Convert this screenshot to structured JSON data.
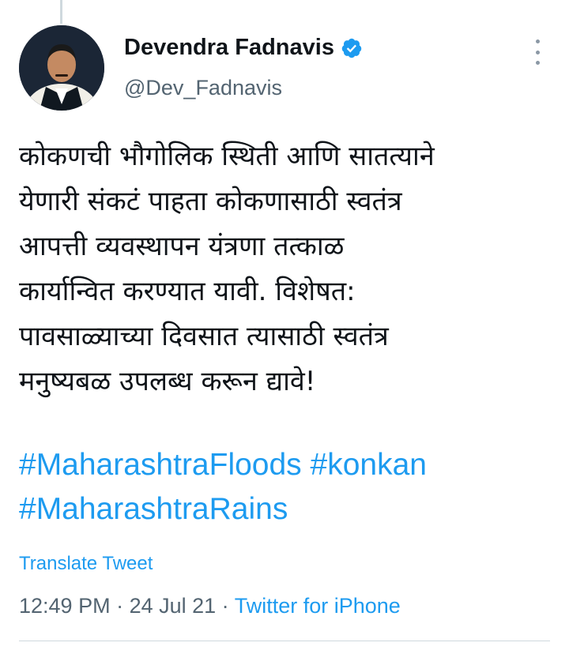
{
  "author": {
    "name": "Devendra Fadnavis",
    "handle": "@Dev_Fadnavis",
    "verified_icon": "verified-badge-icon",
    "avatar_icon": "profile-photo"
  },
  "tweet": {
    "lines": [
      "कोकणची भौगोलिक स्थिती आणि सातत्याने",
      "येणारी संकटं पाहता कोकणासाठी स्वतंत्र",
      "आपत्ती व्यवस्थापन यंत्रणा तत्काळ",
      "कार्यान्वित करण्यात यावी. विशेषत:",
      "पावसाळ्याच्या दिवसात त्यासाठी स्वतंत्र",
      "मनुष्यबळ उपलब्ध करून द्यावे!"
    ],
    "hashtags": [
      "#MaharashtraFloods",
      "#konkan",
      "#MaharashtraRains"
    ]
  },
  "translate_label": "Translate Tweet",
  "meta": {
    "time": "12:49 PM",
    "separator": " · ",
    "date": "24 Jul 21",
    "source": "Twitter for iPhone"
  },
  "colors": {
    "link": "#1d9bf0",
    "secondary_text": "#536471",
    "primary_text": "#0f1419"
  }
}
